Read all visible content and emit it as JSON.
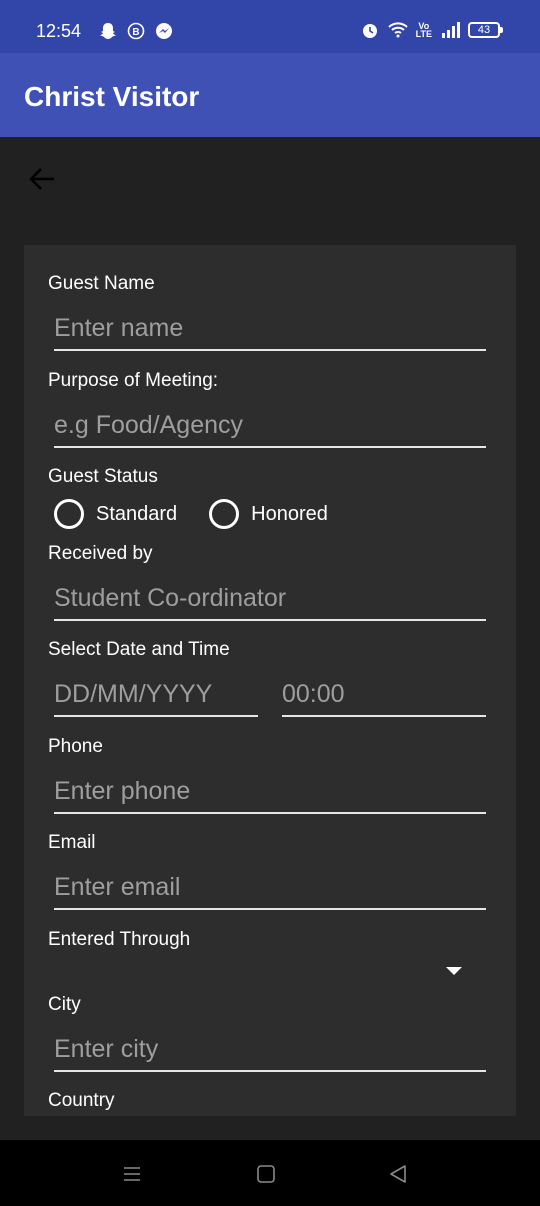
{
  "status_bar": {
    "time": "12:54",
    "battery": "43",
    "volte": "Vo\nLTE"
  },
  "app_bar": {
    "title": "Christ Visitor"
  },
  "form": {
    "guest_name": {
      "label": "Guest Name",
      "placeholder": "Enter name"
    },
    "purpose": {
      "label": "Purpose of Meeting:",
      "placeholder": "e.g Food/Agency"
    },
    "guest_status": {
      "label": "Guest Status",
      "options": [
        "Standard",
        "Honored"
      ]
    },
    "received_by": {
      "label": "Received by",
      "placeholder": "Student Co-ordinator"
    },
    "date_time": {
      "label": "Select Date and Time",
      "date_placeholder": "DD/MM/YYYY",
      "time_placeholder": "00:00"
    },
    "phone": {
      "label": "Phone",
      "placeholder": "Enter phone"
    },
    "email": {
      "label": "Email",
      "placeholder": "Enter email"
    },
    "entered_through": {
      "label": "Entered Through",
      "selected": ""
    },
    "city": {
      "label": "City",
      "placeholder": "Enter city"
    },
    "country": {
      "label": "Country"
    }
  },
  "colors": {
    "status_bar": "#3245a8",
    "app_bar": "#3f51b5",
    "background": "#212121",
    "card": "#2d2d2d"
  }
}
